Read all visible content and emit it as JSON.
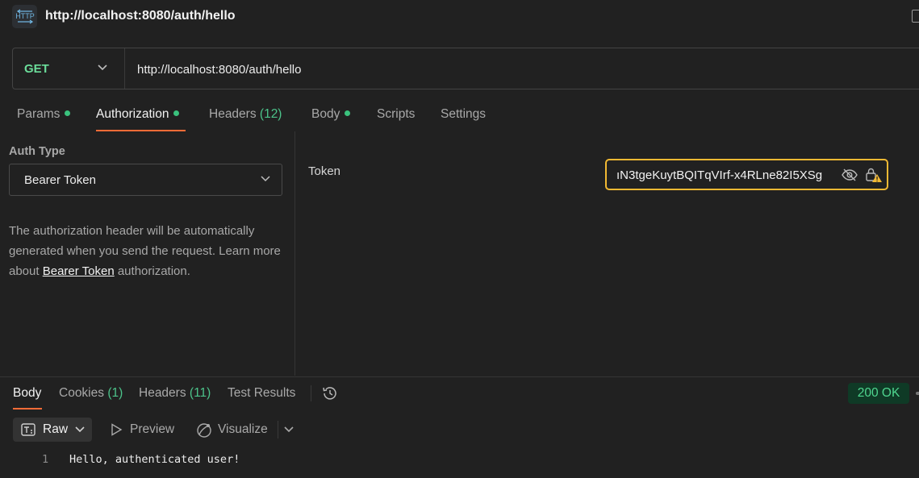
{
  "header": {
    "badge_text": "HTTP",
    "title": "http://localhost:8080/auth/hello"
  },
  "request": {
    "method": "GET",
    "url": "http://localhost:8080/auth/hello"
  },
  "request_tabs": {
    "params": "Params",
    "authorization": "Authorization",
    "headers": "Headers",
    "headers_count": "(12)",
    "body": "Body",
    "scripts": "Scripts",
    "settings": "Settings",
    "active": "Authorization"
  },
  "auth": {
    "type_label": "Auth Type",
    "type_value": "Bearer Token",
    "desc_before": "The authorization header will be automatically generated when you send the request. Learn more about ",
    "desc_link": "Bearer Token",
    "desc_after": " authorization.",
    "token_label": "Token",
    "token_value": "ıN3tgeKuytBQITqVIrf-x4RLne82I5XSg"
  },
  "response": {
    "tabs": {
      "body": "Body",
      "cookies": "Cookies",
      "cookies_count": "(1)",
      "headers": "Headers",
      "headers_count": "(11)",
      "test_results": "Test Results"
    },
    "status": "200 OK",
    "view": {
      "raw": "Raw",
      "preview": "Preview",
      "visualize": "Visualize"
    },
    "lines": [
      {
        "num": "1",
        "text": "Hello, authenticated user!"
      }
    ]
  },
  "colors": {
    "background": "#212121",
    "accent": "#ff6c37",
    "method_get": "#6bdd9a",
    "status_ok": "#4fd68f",
    "token_focus": "#f2b933"
  },
  "icons": [
    "http-icon",
    "chevron-down-icon",
    "eye-off-icon",
    "lock-warning-icon",
    "history-icon",
    "raw-format-icon",
    "play-icon",
    "visualize-icon"
  ]
}
